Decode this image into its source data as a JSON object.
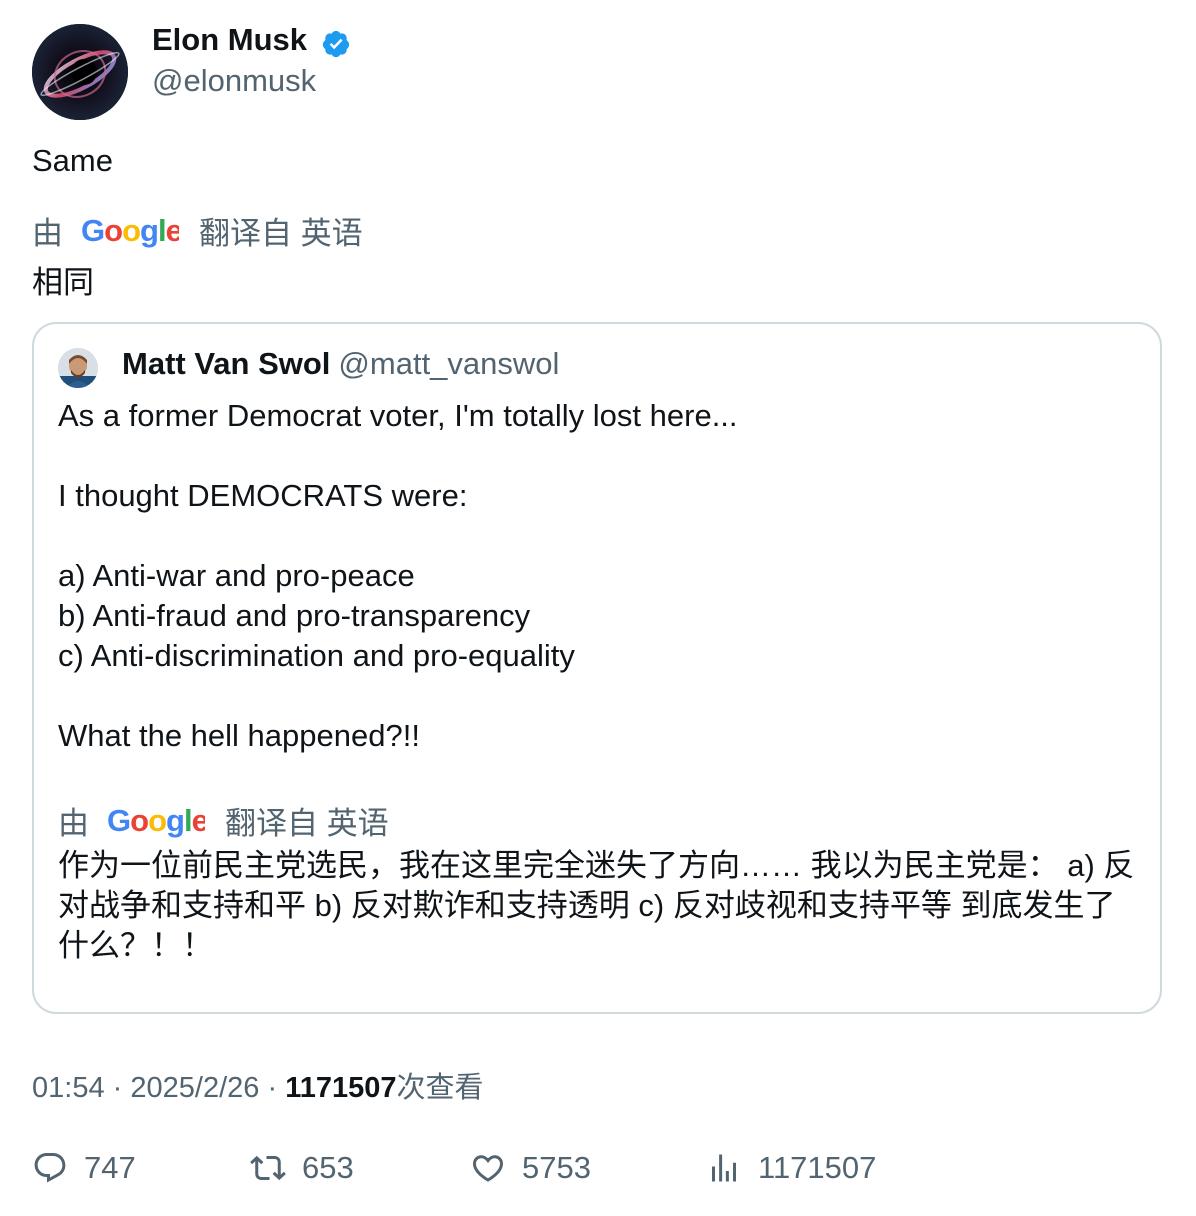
{
  "author": {
    "name": "Elon Musk",
    "handle": "@elonmusk",
    "verified": true
  },
  "tweet": {
    "text": "Same",
    "translation_prefix": "由",
    "translation_provider": "Google",
    "translation_suffix": "翻译自 英语",
    "translated_text": "相同"
  },
  "quote": {
    "name": "Matt Van Swol",
    "handle": "@matt_vanswol",
    "lines": [
      "As a former Democrat voter, I'm totally lost here...",
      "",
      "I thought DEMOCRATS were:",
      "",
      "a) Anti-war and pro-peace",
      "b) Anti-fraud and pro-transparency",
      "c) Anti-discrimination and pro-equality",
      "",
      "What the hell happened?!!"
    ],
    "translation_prefix": "由",
    "translation_provider": "Google",
    "translation_suffix": "翻译自 英语",
    "translated_text": "作为一位前民主党选民，我在这里完全迷失了方向…… 我以为民主党是： a) 反对战争和支持和平 b) 反对欺诈和支持透明 c) 反对歧视和支持平等 到底发生了什么？！！"
  },
  "meta": {
    "time": "01:54",
    "separator": "·",
    "date": "2025/2/26",
    "views_count": "1171507",
    "views_label": "次查看"
  },
  "actions": {
    "replies": "747",
    "retweets": "653",
    "likes": "5753",
    "views": "1171507"
  },
  "colors": {
    "text": "#0f1419",
    "secondary": "#536471",
    "verified": "#1d9bf0",
    "border": "#cfd9de"
  }
}
